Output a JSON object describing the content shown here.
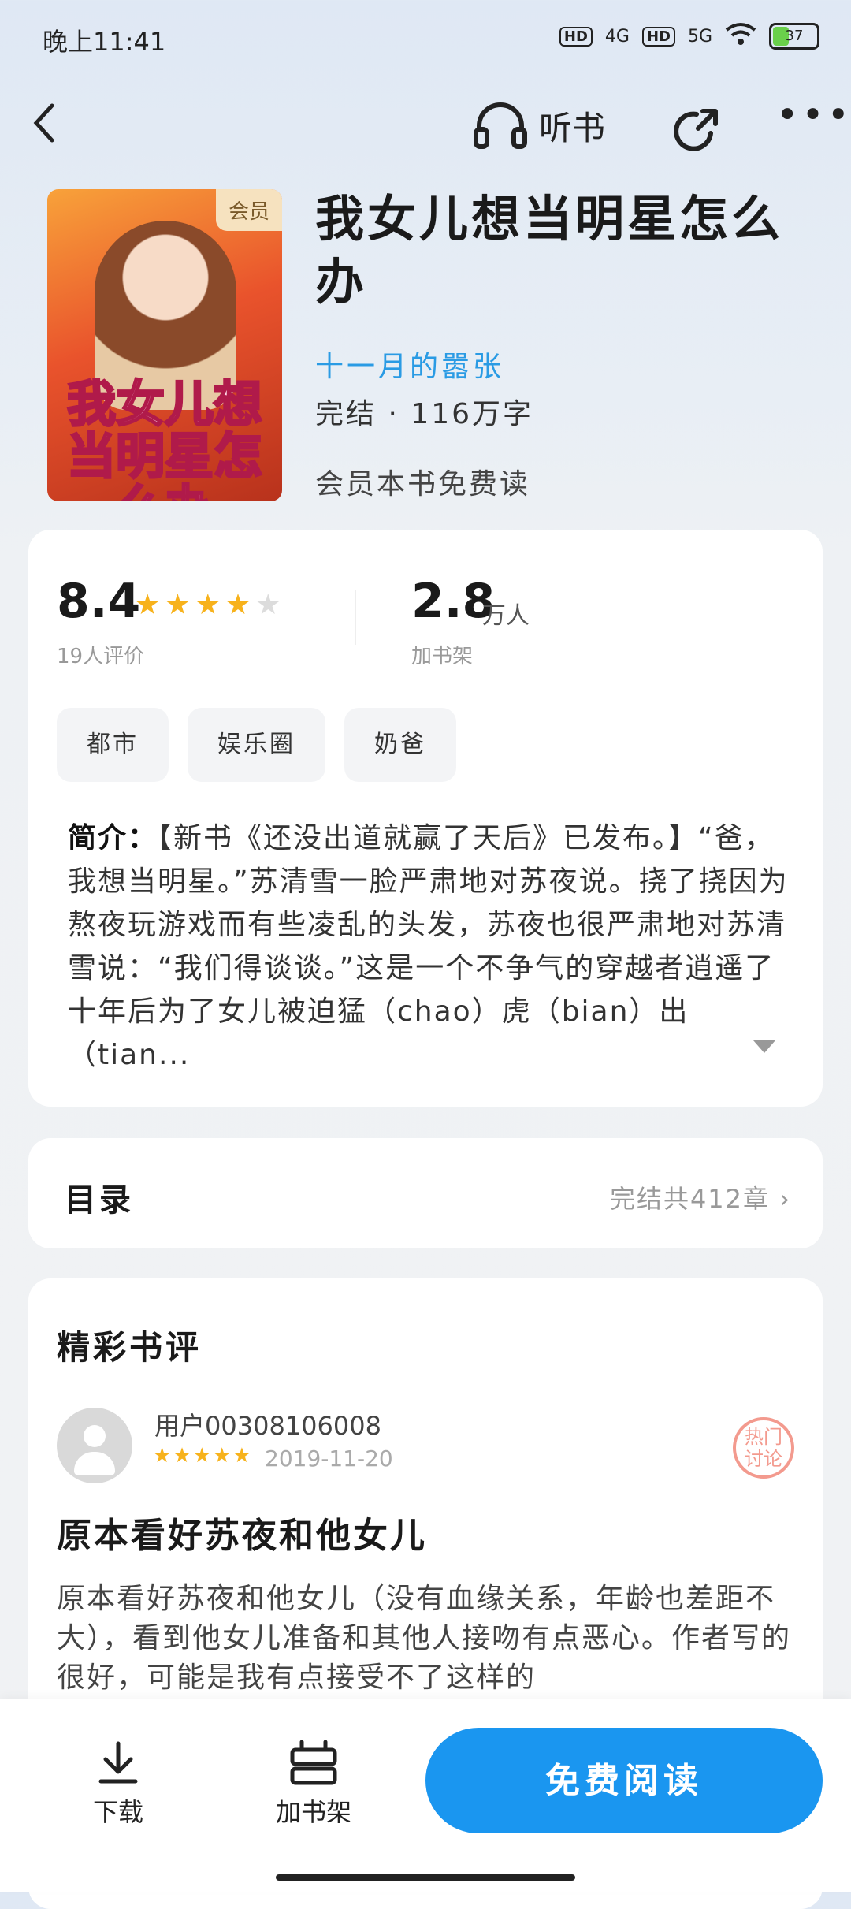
{
  "status_bar": {
    "time": "晚上11:41",
    "net1": "4G",
    "net2": "5G",
    "hd": "HD",
    "battery": "37"
  },
  "header": {
    "listen_label": "听书"
  },
  "book": {
    "title": "我女儿想当明星怎么办",
    "author": "十一月的嚣张",
    "status": "完结 · 116万字",
    "vip_note": "会员本书免费读",
    "cover_badge": "会员",
    "cover_title": "我女儿想当明星怎么办"
  },
  "rating": {
    "score": "8.4",
    "stars_filled": 4,
    "count_label": "19人评价"
  },
  "shelf": {
    "num": "2.8",
    "unit": "万人",
    "label": "加书架"
  },
  "tags": [
    "都市",
    "娱乐圈",
    "奶爸"
  ],
  "intro": {
    "label": "简介：",
    "text": "【新书《还没出道就赢了天后》已发布。】“爸，我想当明星。”苏清雪一脸严肃地对苏夜说。挠了挠因为熬夜玩游戏而有些凌乱的头发，苏夜也很严肃地对苏清雪说：“我们得谈谈。”这是一个不争气的穿越者逍遥了十年后为了女儿被迫猛（chao）虎（bian）出（tian..."
  },
  "toc": {
    "label": "目录",
    "info": "完结共412章 ›"
  },
  "reviews": {
    "heading": "精彩书评",
    "user": "用户00308106008",
    "date": "2019-11-20",
    "hot_badge": "热门讨论",
    "title": "原本看好苏夜和他女儿",
    "body": "原本看好苏夜和他女儿（没有血缘关系，年龄也差距不大），看到他女儿准备和其他人接吻有点恶心。作者写的很好，可能是我有点接受不了这样的"
  },
  "bottom": {
    "download": "下载",
    "add_shelf": "加书架",
    "read": "免费阅读"
  },
  "colors": {
    "accent": "#1a96f0",
    "author": "#2a9be4",
    "star": "#f7b21c"
  }
}
